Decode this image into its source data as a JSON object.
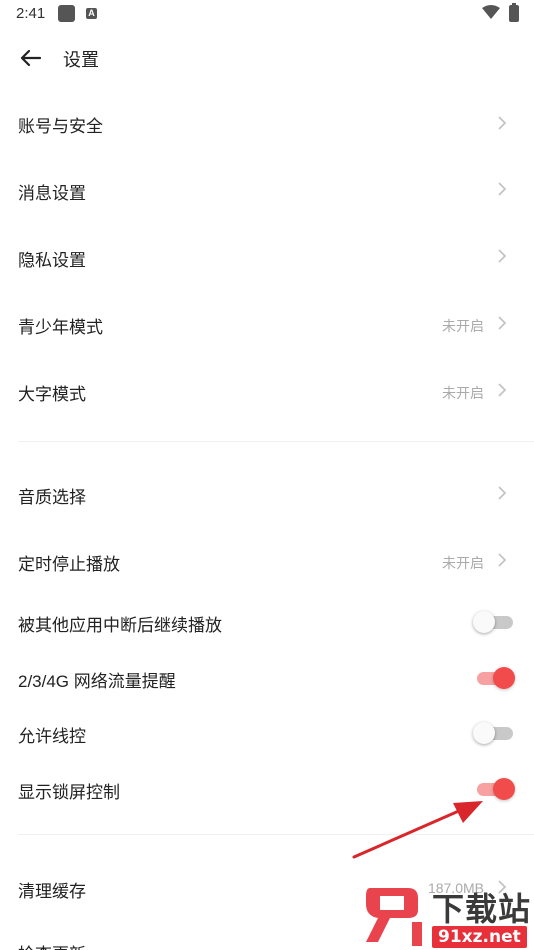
{
  "status_bar": {
    "time": "2:41",
    "a_icon": "A"
  },
  "header": {
    "title": "设置"
  },
  "settings": {
    "account": {
      "label": "账号与安全"
    },
    "message": {
      "label": "消息设置"
    },
    "privacy": {
      "label": "隐私设置"
    },
    "teen": {
      "label": "青少年模式",
      "status": "未开启"
    },
    "bigfont": {
      "label": "大字模式",
      "status": "未开启"
    },
    "quality": {
      "label": "音质选择"
    },
    "timer": {
      "label": "定时停止播放",
      "status": "未开启"
    },
    "resume": {
      "label": "被其他应用中断后继续播放",
      "enabled": false
    },
    "traffic": {
      "label": "2/3/4G 网络流量提醒",
      "enabled": true
    },
    "wire": {
      "label": "允许线控",
      "enabled": false
    },
    "lockscreen": {
      "label": "显示锁屏控制",
      "enabled": true
    },
    "cache": {
      "label": "清理缓存",
      "status": "187.0MB"
    },
    "update": {
      "label": "检查更新"
    }
  },
  "watermark": {
    "text": "下载站",
    "domain": "91xz.net"
  },
  "colors": {
    "accent": "#f24b4b",
    "accent_track": "#f7a1a1",
    "annotation": "#d8262a"
  }
}
